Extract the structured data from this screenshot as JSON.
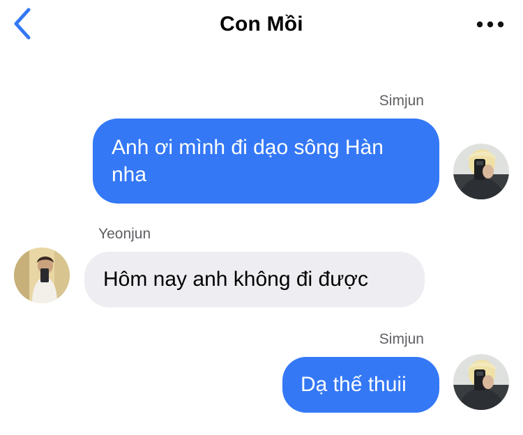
{
  "header": {
    "title": "Con Mồi",
    "back_icon": "chevron-left-icon",
    "more_icon": "more-horizontal-icon"
  },
  "colors": {
    "accent": "#3478f6",
    "incoming_bubble": "#eeeef2",
    "sender_label": "#5f5f63"
  },
  "messages": [
    {
      "sender": "Simjun",
      "direction": "outgoing",
      "text": "Anh ơi mình đi dạo sông Hàn nha"
    },
    {
      "sender": "Yeonjun",
      "direction": "incoming",
      "text": "Hôm nay anh không đi được"
    },
    {
      "sender": "Simjun",
      "direction": "outgoing",
      "text": "Dạ thế thuii"
    }
  ]
}
